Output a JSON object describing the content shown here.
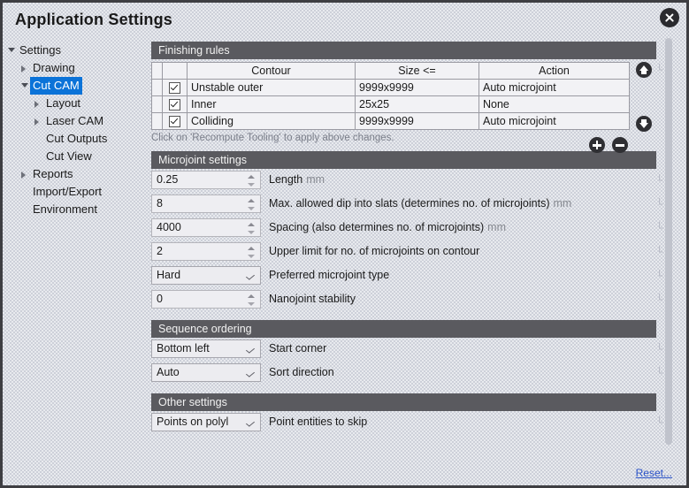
{
  "window": {
    "title": "Application Settings",
    "close_icon": "close-icon"
  },
  "sidebar": {
    "items": [
      {
        "label": "Settings",
        "indent": 0,
        "arrow": "open",
        "selected": false
      },
      {
        "label": "Drawing",
        "indent": 1,
        "arrow": "closed",
        "selected": false
      },
      {
        "label": "Cut CAM",
        "indent": 1,
        "arrow": "open",
        "selected": true
      },
      {
        "label": "Layout",
        "indent": 2,
        "arrow": "closed",
        "selected": false
      },
      {
        "label": "Laser CAM",
        "indent": 2,
        "arrow": "closed",
        "selected": false
      },
      {
        "label": "Cut Outputs",
        "indent": 2,
        "arrow": "none",
        "selected": false
      },
      {
        "label": "Cut View",
        "indent": 2,
        "arrow": "none",
        "selected": false
      },
      {
        "label": "Reports",
        "indent": 1,
        "arrow": "closed",
        "selected": false
      },
      {
        "label": "Import/Export",
        "indent": 1,
        "arrow": "none",
        "selected": false
      },
      {
        "label": "Environment",
        "indent": 1,
        "arrow": "none",
        "selected": false
      }
    ]
  },
  "finishing_rules": {
    "header": "Finishing rules",
    "columns": [
      "",
      "",
      "Contour",
      "Size <=",
      "Action"
    ],
    "rows": [
      {
        "checked": true,
        "contour": "Unstable outer",
        "size": "9999x9999",
        "action": "Auto microjoint"
      },
      {
        "checked": true,
        "contour": "Inner",
        "size": "25x25",
        "action": "None"
      },
      {
        "checked": true,
        "contour": "Colliding",
        "size": "9999x9999",
        "action": "Auto microjoint"
      }
    ],
    "hint": "Click on 'Recompute Tooling' to apply above changes.",
    "buttons": {
      "move_up": "move-up-button",
      "move_down": "move-down-button",
      "add": "add-rule-button",
      "remove": "remove-rule-button"
    }
  },
  "microjoint_settings": {
    "header": "Microjoint settings",
    "fields": [
      {
        "name": "length",
        "value": "0.25",
        "label": "Length",
        "unit": "mm",
        "kind": "spinner"
      },
      {
        "name": "max-dip-into-slats",
        "value": "8",
        "label": "Max. allowed dip into slats (determines no. of microjoints)",
        "unit": "mm",
        "kind": "spinner"
      },
      {
        "name": "spacing",
        "value": "4000",
        "label": "Spacing (also determines no. of microjoints)",
        "unit": "mm",
        "kind": "spinner"
      },
      {
        "name": "upper-limit-microjoints",
        "value": "2",
        "label": "Upper limit for no. of microjoints on contour",
        "unit": "",
        "kind": "spinner"
      },
      {
        "name": "preferred-type",
        "value": "Hard",
        "label": "Preferred microjoint type",
        "unit": "",
        "kind": "dropdown"
      },
      {
        "name": "nanojoint-stability",
        "value": "0",
        "label": "Nanojoint stability",
        "unit": "",
        "kind": "spinner"
      }
    ]
  },
  "sequence_ordering": {
    "header": "Sequence ordering",
    "fields": [
      {
        "name": "start-corner",
        "value": "Bottom left",
        "label": "Start corner",
        "unit": "",
        "kind": "dropdown"
      },
      {
        "name": "sort-direction",
        "value": "Auto",
        "label": "Sort direction",
        "unit": "",
        "kind": "dropdown"
      }
    ]
  },
  "other_settings": {
    "header": "Other settings",
    "fields": [
      {
        "name": "point-entities-to-skip",
        "value": "Points on polyl",
        "label": "Point entities to skip",
        "unit": "",
        "kind": "dropdown"
      }
    ]
  },
  "footer": {
    "reset_label": "Reset..."
  },
  "colors": {
    "section_header_bg": "#5a5a5f",
    "selection_blue": "#0b73d8",
    "link_blue": "#2a52c8",
    "dialog_border": "#3e3e42",
    "background": "#cdd0d9"
  }
}
